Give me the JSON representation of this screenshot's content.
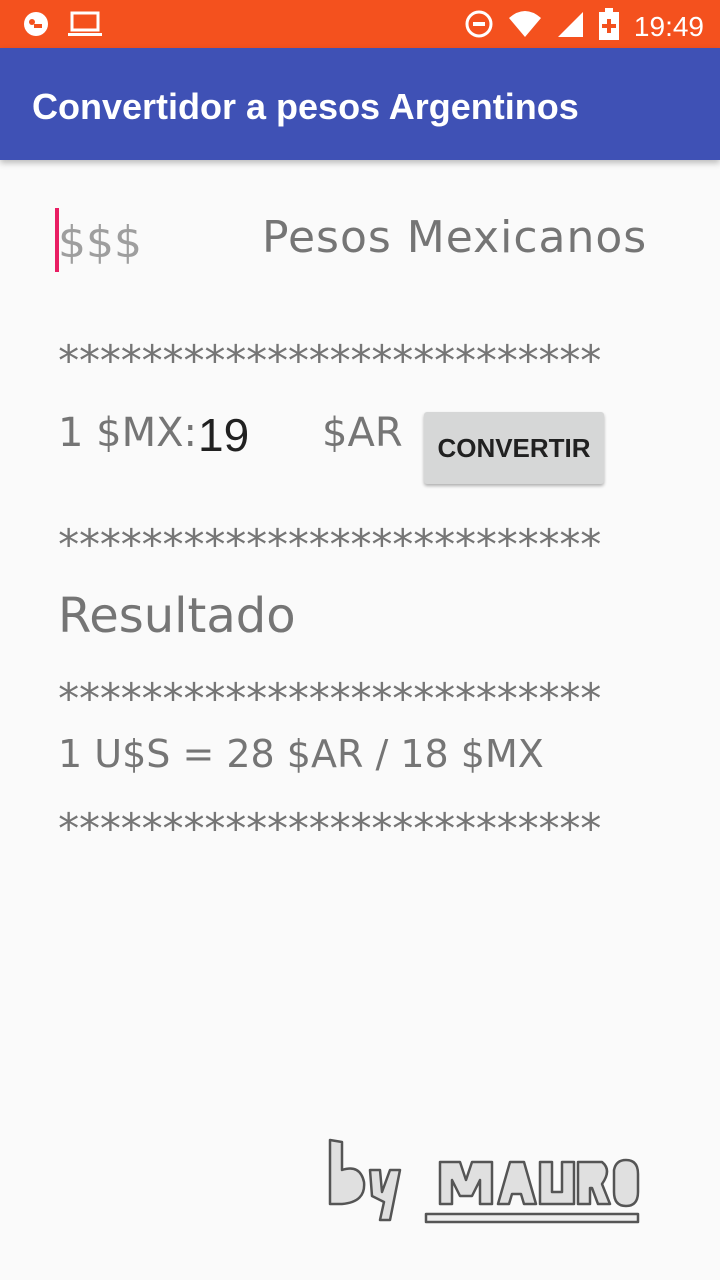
{
  "status_bar": {
    "time": "19:49",
    "icons": [
      "app-notification-icon",
      "laptop-icon",
      "do-not-disturb-icon",
      "wifi-icon",
      "cell-signal-icon",
      "battery-icon"
    ]
  },
  "app_bar": {
    "title": "Convertidor a pesos Argentinos",
    "color": "#3f51b5"
  },
  "form": {
    "amount_placeholder": "$$$",
    "amount_value": "",
    "currency_label": "Pesos Mexicanos",
    "separator": "**************************",
    "rate_label": "1 $MX:",
    "rate_value": "19",
    "target_currency_label": "$AR",
    "convert_button_label": "CONVERTIR",
    "result_label": "Resultado",
    "exchange_note": "1 U$S = 28 $AR / 18 $MX"
  },
  "signature": {
    "text": "by mauro"
  },
  "colors": {
    "status_bar": "#f4511e",
    "accent": "#e91e63",
    "background": "#fafafa",
    "button": "#d6d7d7"
  }
}
